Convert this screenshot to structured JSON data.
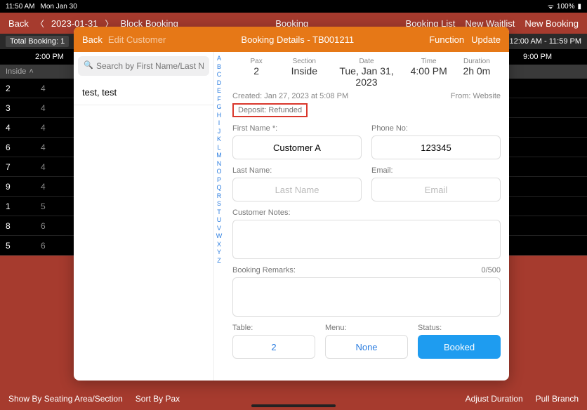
{
  "status": {
    "time": "11:50 AM",
    "date": "Mon Jan 30",
    "wifi": "📶",
    "battery": "100%"
  },
  "nav": {
    "back": "Back",
    "date": "2023-01-31",
    "block": "Block Booking",
    "title": "Booking",
    "booking_list": "Booking List",
    "new_waitlist": "New Waitlist",
    "new_booking": "New Booking"
  },
  "totalbar": {
    "label": "Total Booking:  1",
    "range": "12:00 AM - 11:59 PM"
  },
  "time_header": {
    "t1": "2:00 PM",
    "t2": "9:00 PM"
  },
  "section": "Inside",
  "tables": [
    {
      "num": "2",
      "pax": "4"
    },
    {
      "num": "3",
      "pax": "4"
    },
    {
      "num": "4",
      "pax": "4"
    },
    {
      "num": "6",
      "pax": "4"
    },
    {
      "num": "7",
      "pax": "4"
    },
    {
      "num": "9",
      "pax": "4"
    },
    {
      "num": "1",
      "pax": "5"
    },
    {
      "num": "8",
      "pax": "6"
    },
    {
      "num": "5",
      "pax": "6"
    }
  ],
  "bottom": {
    "show_by": "Show By Seating Area/Section",
    "sort_by": "Sort By Pax",
    "adjust": "Adjust Duration",
    "pull": "Pull Branch"
  },
  "modal": {
    "back": "Back",
    "edit": "Edit Customer",
    "title": "Booking Details - TB001211",
    "function": "Function",
    "update": "Update",
    "search_placeholder": "Search by First Name/Last Na...",
    "customer": "test, test",
    "alpha": [
      "A",
      "B",
      "C",
      "D",
      "E",
      "F",
      "G",
      "H",
      "I",
      "J",
      "K",
      "L",
      "M",
      "N",
      "O",
      "P",
      "Q",
      "R",
      "S",
      "T",
      "U",
      "V",
      "W",
      "X",
      "Y",
      "Z"
    ],
    "summary": {
      "pax_label": "Pax",
      "pax": "2",
      "section_label": "Section",
      "section": "Inside",
      "date_label": "Date",
      "date": "Tue, Jan 31, 2023",
      "time_label": "Time",
      "time": "4:00 PM",
      "duration_label": "Duration",
      "duration": "2h 0m"
    },
    "created": "Created: Jan 27, 2023 at 5:08 PM",
    "from": "From: Website",
    "deposit": "Deposit: Refunded",
    "labels": {
      "first_name": "First Name *:",
      "phone": "Phone No:",
      "last_name": "Last Name:",
      "email": "Email:",
      "notes": "Customer Notes:",
      "remarks": "Booking Remarks:",
      "remarks_count": "0/500",
      "table": "Table:",
      "menu": "Menu:",
      "status": "Status:"
    },
    "values": {
      "first_name": "Customer A",
      "phone": "123345",
      "last_name_ph": "Last Name",
      "email_ph": "Email",
      "table": "2",
      "menu": "None",
      "status": "Booked"
    }
  }
}
